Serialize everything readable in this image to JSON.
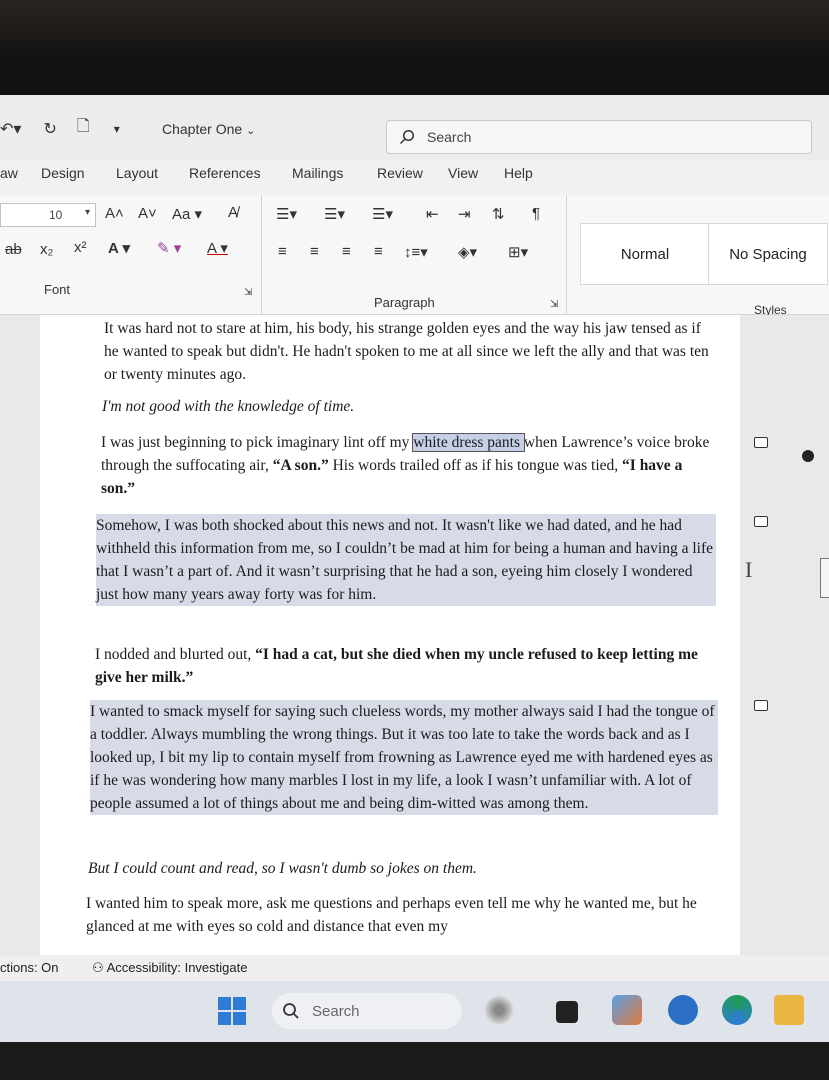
{
  "titlebar": {
    "doc_title": "Chapter One",
    "search_label": "Search"
  },
  "tabs": [
    "aw",
    "Design",
    "Layout",
    "References",
    "Mailings",
    "Review",
    "View",
    "Help"
  ],
  "ribbon": {
    "font_size": "10",
    "font_group_label": "Font",
    "paragraph_group_label": "Paragraph",
    "styles_group_label": "Styles",
    "styles": [
      "Normal",
      "No Spacing"
    ],
    "change_case": "Aa",
    "strike": "ab",
    "subscript": "x₂",
    "superscript": "x²"
  },
  "document": {
    "p1": "It was hard not to stare at him, his body, his strange golden eyes and the way his jaw tensed as if he wanted to speak but didn't. He hadn't spoken to me at all since we left the ally and that was ten or twenty minutes ago.",
    "p2": "I'm not good with the knowledge of time.",
    "p3a": "I was just beginning to pick imaginary lint off my ",
    "p3_sel": "white dress pants ",
    "p3b": "when Lawrence’s voice broke through the suffocating air, ",
    "p3_bold1": "“A son.”",
    "p3c": " His words trailed off as if his tongue was tied, ",
    "p3_bold2": "“I have a son.”",
    "p4": "Somehow, I was both shocked about this news and not. It wasn't like we had dated, and he had withheld this information from me, so I couldn’t be mad at him for being a human and having a life that I wasn’t a part of. And it wasn’t surprising that he had a son, eyeing him closely I wondered just how many years away forty was for him.",
    "p5a": "I nodded and blurted out, ",
    "p5_bold": "“I had a cat, but she died when my uncle refused to keep letting me give her milk.”",
    "p6": "I wanted to smack myself for saying such clueless words, my mother always said I had the tongue of a toddler. Always mumbling the wrong things. But it was too late to take the words back and as I looked up, I bit my lip to contain myself from frowning as Lawrence eyed me with hardened eyes as if he was wondering how many marbles I lost in my life, a look I wasn’t unfamiliar with. A lot of people assumed a lot of things about me and being dim-witted was among them.",
    "p7": "But I could count and read, so I wasn't dumb so jokes on them.",
    "p8": "I wanted him to speak more, ask me questions and perhaps even tell me why he wanted me, but he glanced at me with eyes so cold and distance that even my"
  },
  "statusbar": {
    "predictions": "ctions: On",
    "accessibility": "Accessibility: Investigate"
  },
  "taskbar": {
    "search_label": "Search"
  }
}
